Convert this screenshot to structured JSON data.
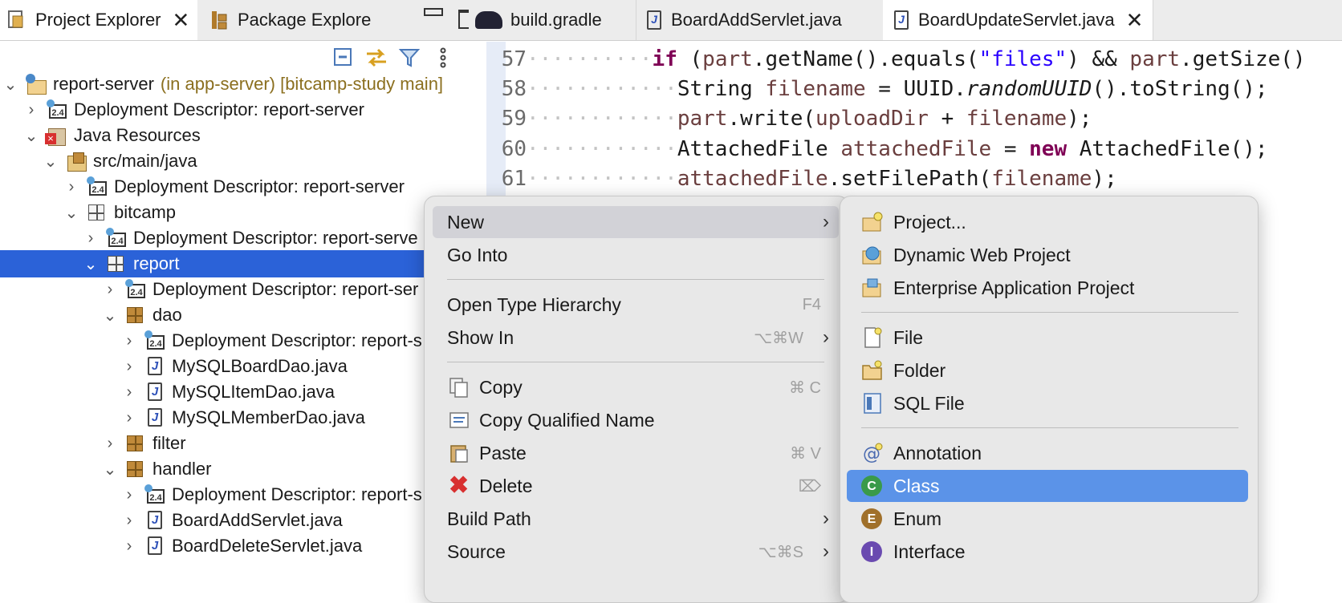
{
  "left_tabs": {
    "project_explorer": "Project Explorer",
    "package_explorer": "Package Explore"
  },
  "tree": [
    {
      "label": "report-server",
      "decoration": "(in app-server) [bitcamp-study main]",
      "icon": "project-icon",
      "expanded": true
    },
    {
      "label": "Deployment Descriptor: report-server",
      "icon": "deployment-descriptor-icon"
    },
    {
      "label": "Java Resources",
      "icon": "java-resources-icon",
      "expanded": true
    },
    {
      "label": "src/main/java",
      "icon": "source-folder-icon",
      "expanded": true
    },
    {
      "label": "Deployment Descriptor: report-server",
      "icon": "deployment-descriptor-icon"
    },
    {
      "label": "bitcamp",
      "icon": "package-icon",
      "expanded": true
    },
    {
      "label": "Deployment Descriptor: report-serve",
      "icon": "deployment-descriptor-icon"
    },
    {
      "label": "report",
      "icon": "package-icon",
      "expanded": true,
      "selected": true
    },
    {
      "label": "Deployment Descriptor: report-ser",
      "icon": "deployment-descriptor-icon"
    },
    {
      "label": "dao",
      "icon": "package-icon",
      "expanded": true
    },
    {
      "label": "Deployment Descriptor: report-s",
      "icon": "deployment-descriptor-icon"
    },
    {
      "label": "MySQLBoardDao.java",
      "icon": "java-file-icon"
    },
    {
      "label": "MySQLItemDao.java",
      "icon": "java-file-icon"
    },
    {
      "label": "MySQLMemberDao.java",
      "icon": "java-file-icon"
    },
    {
      "label": "filter",
      "icon": "package-icon"
    },
    {
      "label": "handler",
      "icon": "package-icon",
      "expanded": true
    },
    {
      "label": "Deployment Descriptor: report-s",
      "icon": "deployment-descriptor-icon"
    },
    {
      "label": "BoardAddServlet.java",
      "icon": "java-file-icon"
    },
    {
      "label": "BoardDeleteServlet.java",
      "icon": "java-file-icon"
    }
  ],
  "editor_tabs": [
    {
      "label": "build.gradle",
      "icon": "gradle-icon"
    },
    {
      "label": "BoardAddServlet.java",
      "icon": "java-file-icon"
    },
    {
      "label": "BoardUpdateServlet.java",
      "icon": "java-file-icon",
      "active": true
    }
  ],
  "code": {
    "l57": {
      "num": "57",
      "if": "if",
      "p1": " (",
      "v1": "part",
      "p2": ".getName().equals(",
      "s1": "\"files\"",
      "p3": ") && ",
      "v2": "part",
      "p4": ".getSize()"
    },
    "l58": {
      "num": "58",
      "t1": "String ",
      "v1": "filename",
      "p1": " = UUID.",
      "m1": "randomUUID",
      "p2": "().toString();"
    },
    "l59": {
      "num": "59",
      "v1": "part",
      "p1": ".write(",
      "v2": "uploadDir",
      "p2": " + ",
      "v3": "filename",
      "p3": ");"
    },
    "l60": {
      "num": "60",
      "t1": "AttachedFile ",
      "v1": "attachedFile",
      "p1": " = ",
      "kw": "new",
      "p2": " AttachedFile();"
    },
    "l61": {
      "num": "61",
      "v1": "attachedFile",
      "p1": ".setFilePath(",
      "v2": "filename",
      "p2": ");"
    }
  },
  "context_menu": {
    "new": "New",
    "go_into": "Go Into",
    "open_type_hierarchy": "Open Type Hierarchy",
    "open_type_hierarchy_shortcut": "F4",
    "show_in": "Show In",
    "show_in_shortcut": "⌥⌘W",
    "copy": "Copy",
    "copy_shortcut": "⌘ C",
    "copy_qualified_name": "Copy Qualified Name",
    "paste": "Paste",
    "paste_shortcut": "⌘ V",
    "delete": "Delete",
    "delete_shortcut": "⌦",
    "build_path": "Build Path",
    "source": "Source",
    "source_shortcut": "⌥⌘S"
  },
  "new_submenu": {
    "project": "Project...",
    "dynamic_web_project": "Dynamic Web Project",
    "enterprise_application_project": "Enterprise Application Project",
    "file": "File",
    "folder": "Folder",
    "sql_file": "SQL File",
    "annotation": "Annotation",
    "class": "Class",
    "enum": "Enum",
    "interface": "Interface"
  },
  "colors": {
    "selection": "#2b62d8",
    "menu_highlight": "#5b93e8",
    "keyword": "#7f0055",
    "string": "#2a00ff",
    "variable": "#6a3e3e"
  }
}
